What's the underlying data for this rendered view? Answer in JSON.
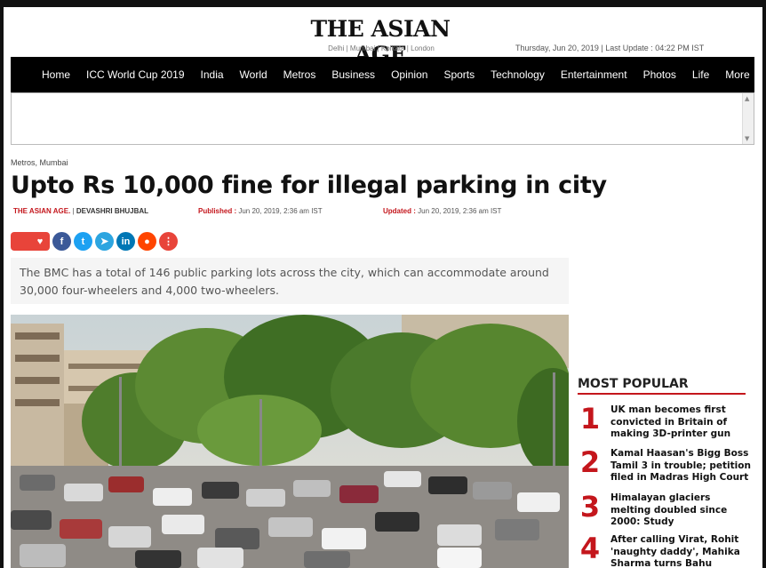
{
  "header": {
    "logo": "THE ASIAN AGE",
    "editions": "Delhi | Mumbai | Kolkata | London",
    "dateline": "Thursday, Jun 20, 2019 | Last Update : 04:22 PM IST"
  },
  "nav": [
    {
      "label": "Home"
    },
    {
      "label": "ICC World Cup 2019"
    },
    {
      "label": "India"
    },
    {
      "label": "World"
    },
    {
      "label": "Metros"
    },
    {
      "label": "Business"
    },
    {
      "label": "Opinion"
    },
    {
      "label": "Sports"
    },
    {
      "label": "Technology"
    },
    {
      "label": "Entertainment"
    },
    {
      "label": "Photos"
    },
    {
      "label": "Life"
    },
    {
      "label": "More"
    }
  ],
  "article": {
    "breadcrumb": "Metros, Mumbai",
    "headline": "Upto Rs 10,000 fine for illegal parking in city",
    "publication": "THE ASIAN AGE.",
    "author": "DEVASHRI BHUJBAL",
    "published_label": "Published :",
    "published": "Jun 20, 2019, 2:36 am IST",
    "updated_label": "Updated :",
    "updated": "Jun 20, 2019, 2:36 am IST",
    "summary": "The BMC has a total of 146 public parking lots across the city, which can accommodate around 30,000 four-wheelers and 4,000 two-wheelers."
  },
  "share": [
    {
      "name": "comment-icon",
      "glyph": "",
      "color": "#e8443a"
    },
    {
      "name": "heart-icon",
      "glyph": "♥",
      "color": "#e8443a"
    },
    {
      "name": "facebook-icon",
      "glyph": "f",
      "color": "#3b5998"
    },
    {
      "name": "twitter-icon",
      "glyph": "t",
      "color": "#1da1f2"
    },
    {
      "name": "telegram-icon",
      "glyph": "➤",
      "color": "#2ca5e0"
    },
    {
      "name": "linkedin-icon",
      "glyph": "in",
      "color": "#0077b5"
    },
    {
      "name": "reddit-icon",
      "glyph": "●",
      "color": "#ff4500"
    },
    {
      "name": "more-share-icon",
      "glyph": "⋮",
      "color": "#e8443a"
    }
  ],
  "sidebar": {
    "title": "MOST POPULAR",
    "items": [
      {
        "num": "1",
        "text": "UK man becomes first convicted in Britain of making 3D-printer gun"
      },
      {
        "num": "2",
        "text": "Kamal Haasan's Bigg Boss Tamil 3 in trouble; petition filed in Madras High Court"
      },
      {
        "num": "3",
        "text": "Himalayan glaciers melting doubled since 2000: Study"
      },
      {
        "num": "4",
        "text": "After calling Virat, Rohit 'naughty daddy', Mahika Sharma turns Bahu"
      }
    ]
  },
  "colors": {
    "accent": "#c4161c",
    "nav_bg": "#000000"
  }
}
